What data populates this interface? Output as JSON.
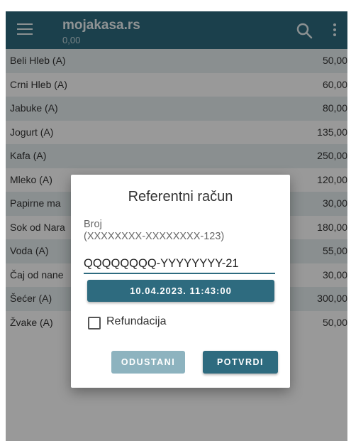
{
  "appbar": {
    "title": "mojakasa.rs",
    "subtitle": "0,00",
    "menu_icon": "hamburger-menu-icon",
    "search_icon": "search-icon",
    "more_icon": "more-vertical-icon"
  },
  "items": [
    {
      "name": "Beli Hleb (A)",
      "price": "50,00"
    },
    {
      "name": "Crni Hleb (A)",
      "price": "60,00"
    },
    {
      "name": "Jabuke (A)",
      "price": "80,00"
    },
    {
      "name": "Jogurt (A)",
      "price": "135,00"
    },
    {
      "name": "Kafa (A)",
      "price": "250,00"
    },
    {
      "name": "Mleko (A)",
      "price": "120,00"
    },
    {
      "name": "Papirne ma",
      "price": "30,00"
    },
    {
      "name": "Sok od Nara",
      "price": "180,00"
    },
    {
      "name": "Voda (A)",
      "price": "55,00"
    },
    {
      "name": "Čaj od nane",
      "price": "30,00"
    },
    {
      "name": "Šećer (A)",
      "price": "300,00"
    },
    {
      "name": "Žvake (A)",
      "price": "50,00"
    }
  ],
  "dialog": {
    "title": "Referentni račun",
    "label_line1": "Broj",
    "label_line2": "(XXXXXXXX-XXXXXXXX-123)",
    "input_value": "QQQQQQQQ-YYYYYYYY-21",
    "datetime_button": "10.04.2023. 11:43:00",
    "refund_label": "Refundacija",
    "refund_checked": false,
    "cancel_label": "ODUSTANI",
    "confirm_label": "POTVRDI"
  },
  "colors": {
    "primary": "#2e6b7f",
    "primary_disabled": "#8db3bf",
    "row_shade": "#e6eef1"
  }
}
